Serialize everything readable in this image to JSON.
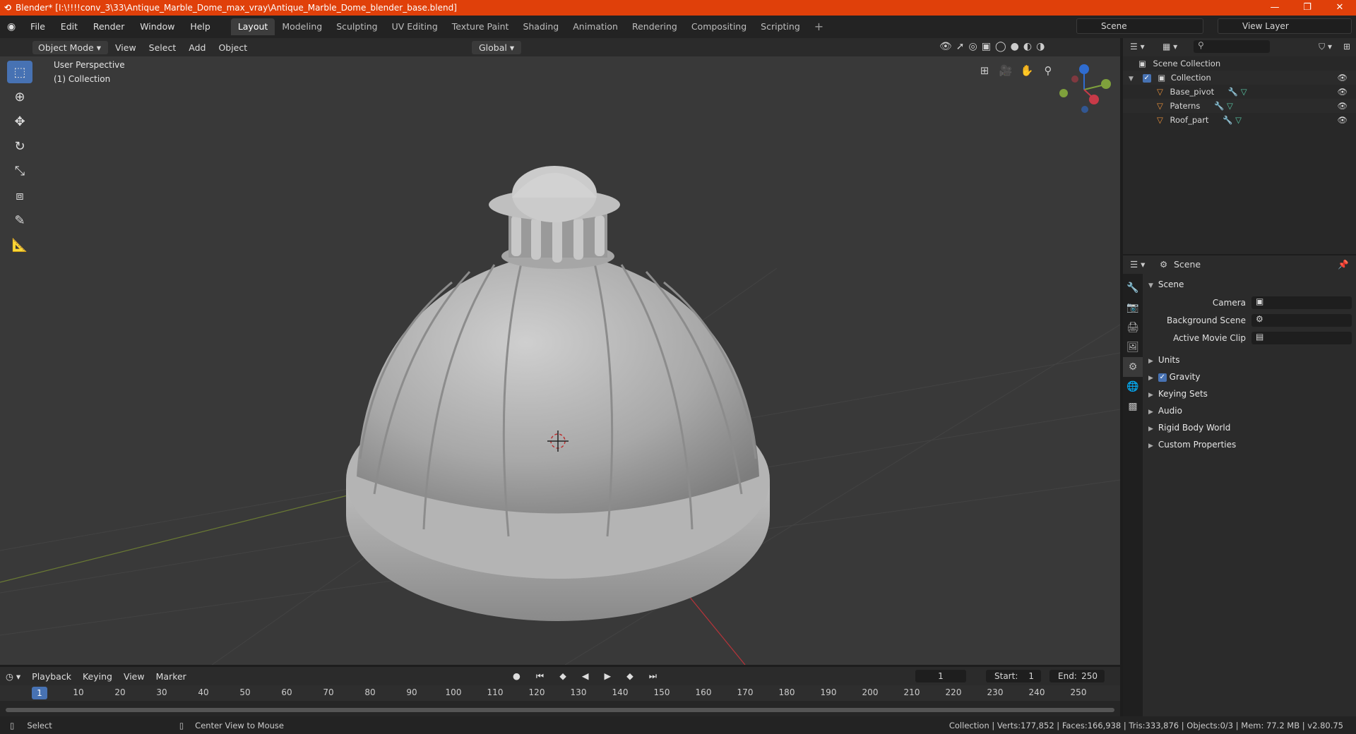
{
  "window": {
    "title": "Blender* [I:\\!!!!conv_3\\33\\Antique_Marble_Dome_max_vray\\Antique_Marble_Dome_blender_base.blend]"
  },
  "menu": [
    "File",
    "Edit",
    "Render",
    "Window",
    "Help"
  ],
  "workspaces": [
    "Layout",
    "Modeling",
    "Sculpting",
    "UV Editing",
    "Texture Paint",
    "Shading",
    "Animation",
    "Rendering",
    "Compositing",
    "Scripting"
  ],
  "scene_name": "Scene",
  "view_layer": "View Layer",
  "viewport": {
    "mode": "Object Mode",
    "menus": [
      "View",
      "Select",
      "Add",
      "Object"
    ],
    "orientation": "Global",
    "perspective": "User Perspective",
    "collection": "(1) Collection"
  },
  "outliner": {
    "root": "Scene Collection",
    "collection": "Collection",
    "objects": [
      "Base_pivot",
      "Paterns",
      "Roof_part"
    ]
  },
  "properties": {
    "header": "Scene",
    "panel": "Scene",
    "camera_label": "Camera",
    "bg_scene_label": "Background Scene",
    "movie_clip_label": "Active Movie Clip",
    "subpanels": [
      "Units",
      "Gravity",
      "Keying Sets",
      "Audio",
      "Rigid Body World",
      "Custom Properties"
    ]
  },
  "timeline": {
    "menus": [
      "Playback",
      "Keying",
      "View",
      "Marker"
    ],
    "current_frame": "1",
    "start": "Start:",
    "start_value": "1",
    "end": "End:",
    "end_value": "250",
    "ticks": [
      "10",
      "20",
      "30",
      "40",
      "50",
      "60",
      "70",
      "80",
      "90",
      "100",
      "110",
      "120",
      "130",
      "140",
      "150",
      "160",
      "170",
      "180",
      "190",
      "200",
      "210",
      "220",
      "230",
      "240",
      "250"
    ]
  },
  "statusbar": {
    "select": "Select",
    "center": "Center View to Mouse",
    "stats": "Collection | Verts:177,852 | Faces:166,938 | Tris:333,876 | Objects:0/3 | Mem: 77.2 MB | v2.80.75"
  }
}
